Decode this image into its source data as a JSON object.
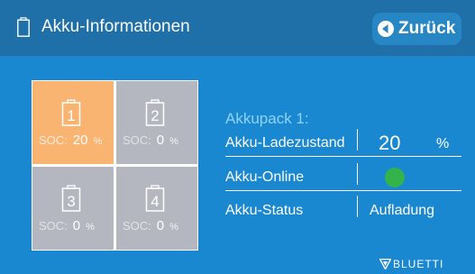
{
  "header": {
    "title": "Akku-Informationen",
    "back_label": "Zurück"
  },
  "batteries": [
    {
      "number": "1",
      "soc_label": "SOC:",
      "soc_value": "20",
      "unit": "%",
      "selected": true
    },
    {
      "number": "2",
      "soc_label": "SOC:",
      "soc_value": "0",
      "unit": "%",
      "selected": false
    },
    {
      "number": "3",
      "soc_label": "SOC:",
      "soc_value": "0",
      "unit": "%",
      "selected": false
    },
    {
      "number": "4",
      "soc_label": "SOC:",
      "soc_value": "0",
      "unit": "%",
      "selected": false
    }
  ],
  "details": {
    "pack_title": "Akkupack 1:",
    "rows": [
      {
        "label": "Akku-Ladezustand",
        "value": "20",
        "unit": "%"
      },
      {
        "label": "Akku-Online",
        "indicator_color": "#33b34a"
      },
      {
        "label": "Akku-Status",
        "value": "Aufladung"
      }
    ]
  },
  "brand": {
    "name": "BLUETTI"
  },
  "colors": {
    "background": "#1a88d1",
    "header": "#1f6fa8",
    "selected_cell": "#f8b470",
    "cell": "#b4b7bf",
    "online": "#33b34a"
  }
}
